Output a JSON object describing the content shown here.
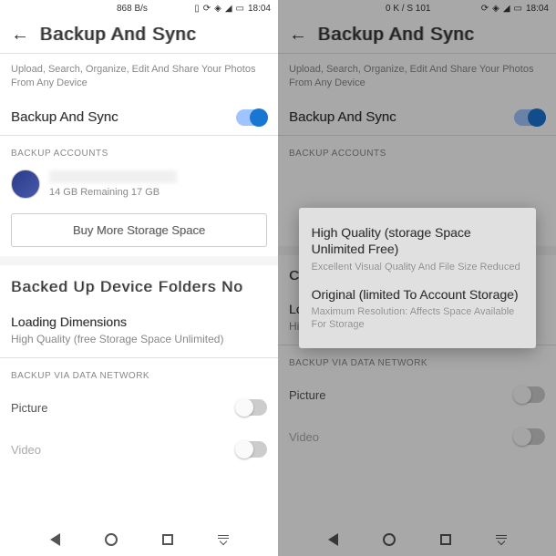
{
  "left": {
    "status": {
      "rate": "868 B/s",
      "time": "18:04"
    },
    "header": {
      "title": "Backup And Sync"
    },
    "subtitle": "Upload, Search, Organize, Edit And Share Your Photos From Any Device",
    "sync": {
      "label": "Backup And Sync"
    },
    "backup_accounts_label": "BACKUP ACCOUNTS",
    "account": {
      "storage": "14 GB Remaining 17 GB"
    },
    "buy_label": "Buy More Storage Space",
    "folders_title": "Backed Up Device Folders No",
    "loading": "Loading Dimensions",
    "quality": "High Quality (free Storage Space Unlimited)",
    "network_label": "BACKUP VIA DATA NETWORK",
    "picture": "Picture",
    "video": "Video"
  },
  "right": {
    "status": {
      "rate": "0 K / S 101",
      "time": "18:04"
    },
    "header": {
      "title": "Backup And Sync"
    },
    "subtitle": "Upload, Search, Organize, Edit And Share Your Photos From Any Device",
    "sync": {
      "label": "Backup And Sync"
    },
    "backup_accounts_label": "BACKUP ACCOUNTS",
    "folders_initial": "C",
    "loading": "Loading Dimensions",
    "quality": "High Quality (free Storage Space Unlimited)",
    "network_label": "BACKUP VIA DATA NETWORK",
    "picture": "Picture",
    "video": "Video",
    "dialog": {
      "opt1": {
        "title": "High Quality (storage Space Unlimited Free)",
        "desc": "Excellent Visual Quality And File Size Reduced"
      },
      "opt2": {
        "title": "Original (limited To Account Storage)",
        "desc": "Maximum Resolution: Affects Space Available For Storage"
      }
    }
  }
}
